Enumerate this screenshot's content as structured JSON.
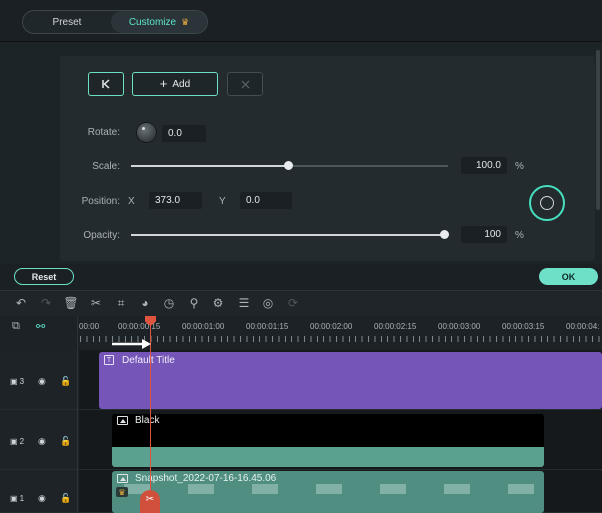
{
  "tabs": {
    "preset": "Preset",
    "customize": "Customize"
  },
  "keyframe": {
    "prev_icon": "keyframe-prev-icon",
    "add_label": "Add",
    "delete_icon": "keyframe-delete-icon"
  },
  "properties": {
    "rotate_label": "Rotate:",
    "rotate_value": "0.0",
    "scale_label": "Scale:",
    "scale_value": "100.0",
    "scale_unit": "%",
    "scale_fraction": 0.495,
    "position_label": "Position:",
    "x_label": "X",
    "x_value": "373.0",
    "y_label": "Y",
    "y_value": "0.0",
    "opacity_label": "Opacity:",
    "opacity_value": "100",
    "opacity_unit": "%",
    "opacity_fraction": 1.0
  },
  "actions": {
    "reset": "Reset",
    "ok": "OK"
  },
  "ruler": {
    "labels": [
      "00:00",
      "00:00:00:15",
      "00:00:01:00",
      "00:00:01:15",
      "00:00:02:00",
      "00:00:02:15",
      "00:00:03:00",
      "00:00:03:15",
      "00:00:04:"
    ]
  },
  "tracks": [
    {
      "number": "3",
      "clip": "Default Title",
      "clip_color": "#7556b8"
    },
    {
      "number": "2",
      "clip": "Black",
      "clip_color": "#000000"
    },
    {
      "number": "1",
      "clip": "Snapshot_2022-07-16-16.45.06",
      "clip_color": "#4f8e81"
    }
  ],
  "colors": {
    "accent": "#6ee0c8",
    "playhead": "#e0533f",
    "title_clip": "#7556b8"
  }
}
